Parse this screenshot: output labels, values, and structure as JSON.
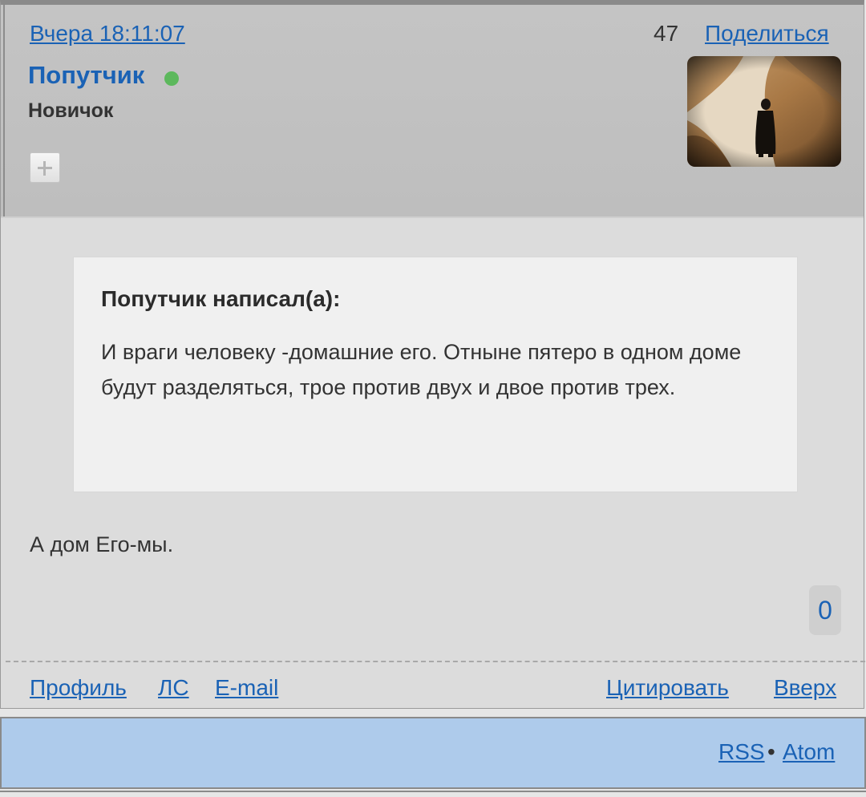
{
  "post": {
    "date": "Вчера 18:11:07",
    "number": "47",
    "share_label": "Поделиться",
    "author": "Попутчик",
    "author_online": true,
    "rank": "Новичок",
    "avatar_description_icon": "monk-walking-road-avatar",
    "quote": {
      "title": "Попутчик написал(а):",
      "text": "И враги человеку -домашние его. Отныне пятеро в одном доме будут разделяться, трое против двух и двое против трех."
    },
    "message": "А дом Его-мы.",
    "likes": "0",
    "footer_links": {
      "profile": "Профиль",
      "pm": "ЛС",
      "email": "E-mail",
      "quote": "Цитировать",
      "top": "Вверх"
    }
  },
  "feeds": {
    "rss": "RSS",
    "separator": "•",
    "atom": "Atom"
  },
  "colors": {
    "link": "#1a62b5",
    "online": "#5cb85c",
    "feed_bar": "#aecbeb"
  }
}
